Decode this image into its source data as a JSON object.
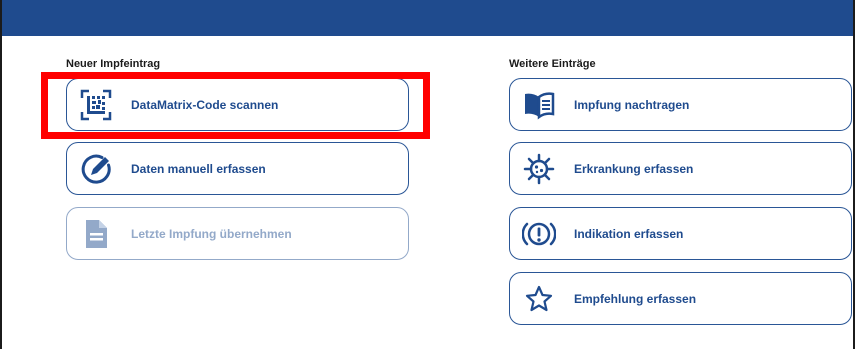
{
  "colors": {
    "brand": "#1f4b8e",
    "disabled": "#93a9c9",
    "highlight": "#ff0000"
  },
  "left": {
    "title": "Neuer Impfeintrag",
    "buttons": [
      {
        "label": "DataMatrix-Code scannen",
        "icon": "datamatrix-scan-icon",
        "enabled": true,
        "highlighted": true
      },
      {
        "label": "Daten manuell erfassen",
        "icon": "pencil-circle-icon",
        "enabled": true
      },
      {
        "label": "Letzte Impfung übernehmen",
        "icon": "document-icon",
        "enabled": false
      }
    ]
  },
  "right": {
    "title": "Weitere Einträge",
    "buttons": [
      {
        "label": "Impfung nachtragen",
        "icon": "book-icon",
        "enabled": true
      },
      {
        "label": "Erkrankung erfassen",
        "icon": "virus-icon",
        "enabled": true
      },
      {
        "label": "Indikation erfassen",
        "icon": "alert-circle-icon",
        "enabled": true
      },
      {
        "label": "Empfehlung erfassen",
        "icon": "star-icon",
        "enabled": true
      }
    ]
  }
}
